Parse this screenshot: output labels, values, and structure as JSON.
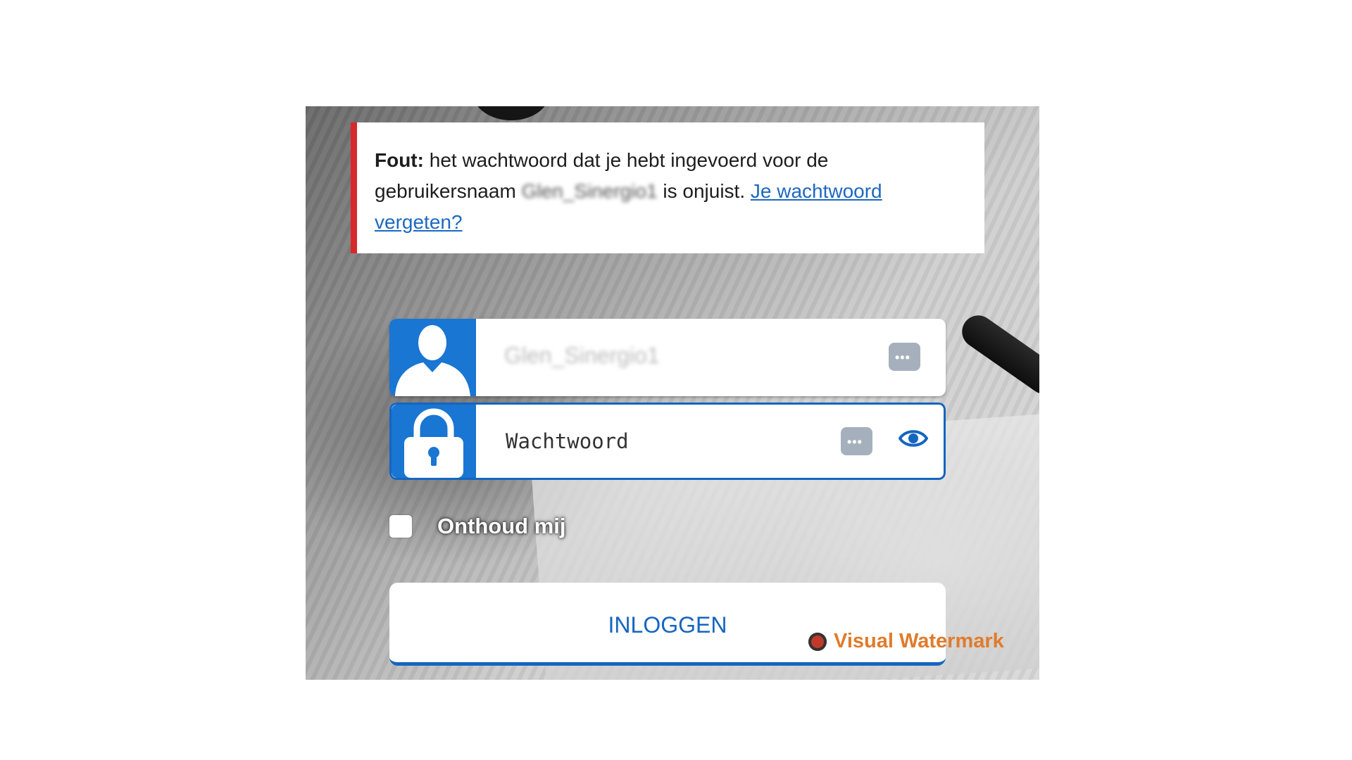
{
  "error": {
    "label": "Fout:",
    "message_part1": "het wachtwoord dat je hebt ingevoerd voor de gebruikersnaam",
    "username_redacted": "Glen_Sinergio1",
    "message_part2": "is onjuist.",
    "link": "Je wachtwoord vergeten?",
    "accent_color": "#d9282b"
  },
  "form": {
    "username_value": "Glen_Sinergio1",
    "password_placeholder": "Wachtwoord",
    "password_manager_glyph": "•••",
    "remember_label": "Onthoud mij",
    "remember_checked": false,
    "login_button": "INLOGGEN"
  },
  "watermark": {
    "text": "Visual Watermark"
  },
  "colors": {
    "brand_blue": "#1976d2",
    "button_text": "#1565c0",
    "link": "#1d68c0"
  }
}
